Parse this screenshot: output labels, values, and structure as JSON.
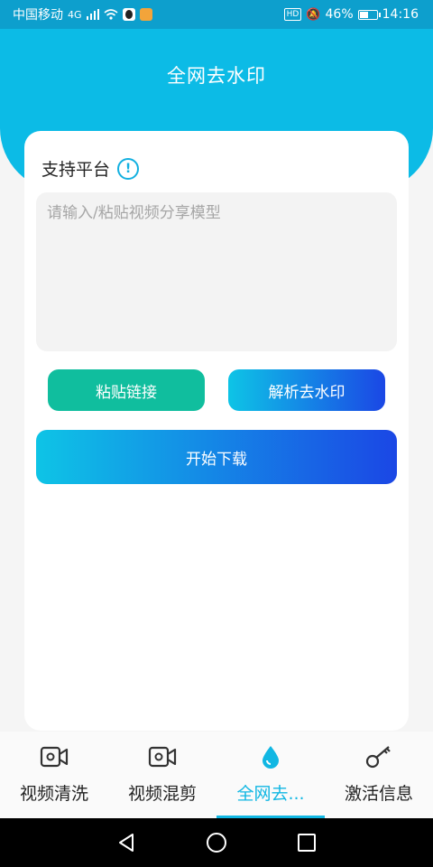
{
  "status_bar": {
    "carrier": "中国移动",
    "network": "4G",
    "hd": "HD",
    "battery": "46%",
    "time": "14:16"
  },
  "header": {
    "title": "全网去水印"
  },
  "card": {
    "support_label": "支持平台",
    "input": {
      "placeholder": "请输入/粘贴视频分享模型",
      "value": ""
    },
    "paste_button": "粘贴链接",
    "parse_button": "解析去水印",
    "download_button": "开始下载"
  },
  "tabs": [
    {
      "label": "视频清洗",
      "icon": "video-camera-icon",
      "active": false
    },
    {
      "label": "视频混剪",
      "icon": "video-camera-icon",
      "active": false
    },
    {
      "label": "全网去...",
      "icon": "water-drop-icon",
      "active": true
    },
    {
      "label": "激活信息",
      "icon": "key-icon",
      "active": false
    }
  ],
  "colors": {
    "header": "#0cbbe6",
    "accent": "#11b7e3",
    "paste_button": "#10be9e",
    "gradient_start": "#0ec4e6",
    "gradient_end": "#1b47e5"
  }
}
